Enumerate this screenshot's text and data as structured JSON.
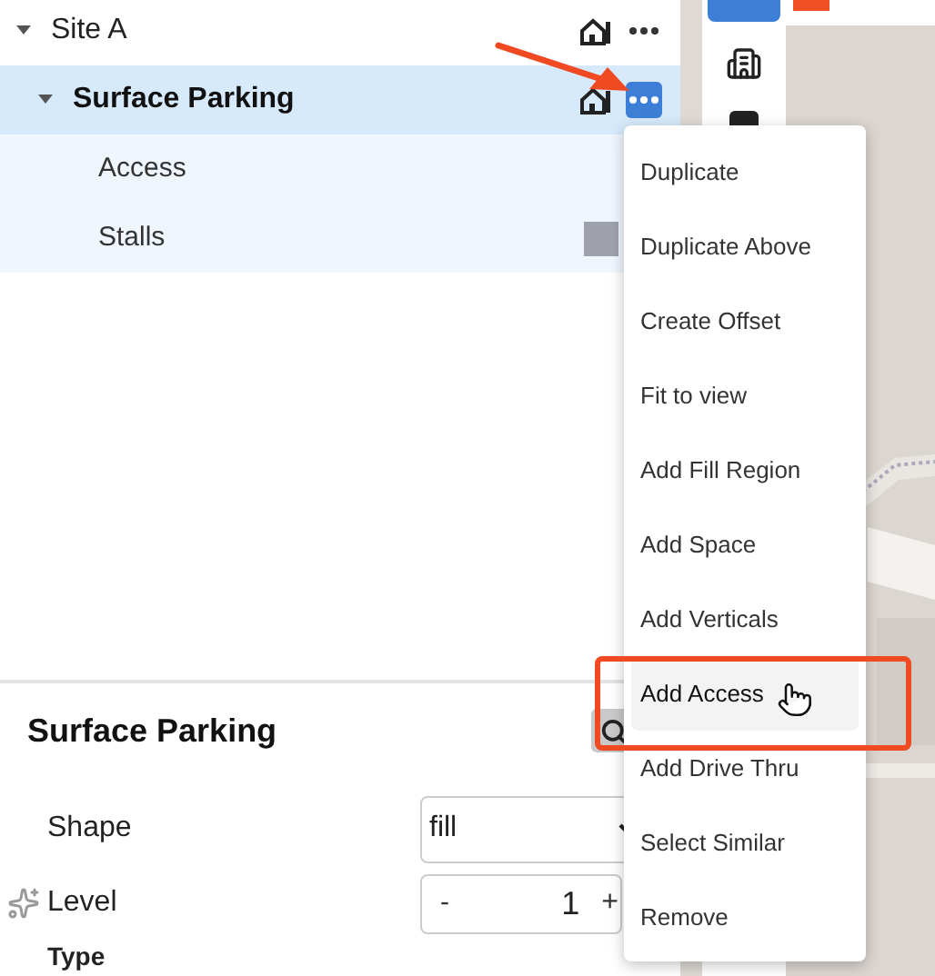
{
  "tree": [
    {
      "label": "Site A",
      "expanded": true,
      "selected": false,
      "menu_open": false,
      "children": [
        {
          "label": "Surface Parking",
          "expanded": true,
          "selected": true,
          "menu_open": true,
          "children": [
            {
              "label": "Access"
            },
            {
              "label": "Stalls",
              "color": "#9fa2ab"
            }
          ]
        }
      ]
    }
  ],
  "context_menu": {
    "items": [
      {
        "label": "Duplicate",
        "selected": false
      },
      {
        "label": "Duplicate Above",
        "selected": false
      },
      {
        "label": "Create Offset",
        "selected": false
      },
      {
        "label": "Fit to view",
        "selected": false
      },
      {
        "label": "Add Fill Region",
        "selected": false
      },
      {
        "label": "Add Space",
        "selected": false
      },
      {
        "label": "Add Verticals",
        "selected": false
      },
      {
        "label": "Add Access",
        "selected": true
      },
      {
        "label": "Add Drive Thru",
        "selected": false
      },
      {
        "label": "Select Similar",
        "selected": false
      },
      {
        "label": "Remove",
        "selected": false
      }
    ]
  },
  "details": {
    "title": "Surface Parking",
    "fields": [
      {
        "kind": "select",
        "label": "Shape",
        "value": "fill"
      },
      {
        "kind": "stepper",
        "label": "Level",
        "minus": "-",
        "value": "1",
        "plus": "+"
      },
      {
        "kind": "heading",
        "label": "Type"
      }
    ]
  }
}
